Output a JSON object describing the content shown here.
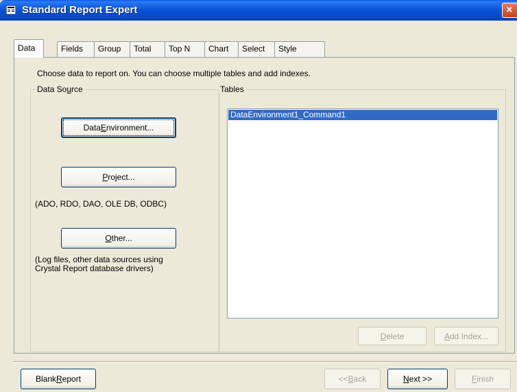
{
  "window": {
    "title": "Standard Report Expert",
    "close_glyph": "×"
  },
  "tabs": [
    {
      "label": "Data",
      "active": true
    },
    {
      "label": "Fields"
    },
    {
      "label": "Group"
    },
    {
      "label": "Total"
    },
    {
      "label": "Top N"
    },
    {
      "label": "Chart"
    },
    {
      "label": "Select"
    },
    {
      "label": "Style"
    }
  ],
  "instruction": "Choose data to report on. You can choose multiple tables and add indexes.",
  "data_source": {
    "label_pre": "Data So",
    "label_mnemonic": "u",
    "label_post": "rce",
    "env_pre": "Data ",
    "env_mnemonic": "E",
    "env_post": "nvironment...",
    "project_mnemonic": "P",
    "project_post": "roject...",
    "project_note": "(ADO, RDO, DAO, OLE DB, ODBC)",
    "other_mnemonic": "O",
    "other_post": "ther...",
    "other_note_line1": "(Log files, other data sources using",
    "other_note_line2": "Crystal Report database drivers)"
  },
  "tables": {
    "label": "Tables",
    "items": [
      "DataEnvironment1_Command1"
    ],
    "delete_mnemonic": "D",
    "delete_post": "elete",
    "add_index_mnemonic": "A",
    "add_index_post": "dd Index..."
  },
  "footer": {
    "blank_pre": "Blank ",
    "blank_mnemonic": "R",
    "blank_post": "eport",
    "back_pre": "<< ",
    "back_mnemonic": "B",
    "back_post": "ack",
    "next_mnemonic": "N",
    "next_post": "ext >>",
    "finish_mnemonic": "F",
    "finish_post": "inish"
  },
  "colors": {
    "titlebar": "#0a55d8",
    "selection": "#316ac5",
    "face": "#ece9d8"
  }
}
